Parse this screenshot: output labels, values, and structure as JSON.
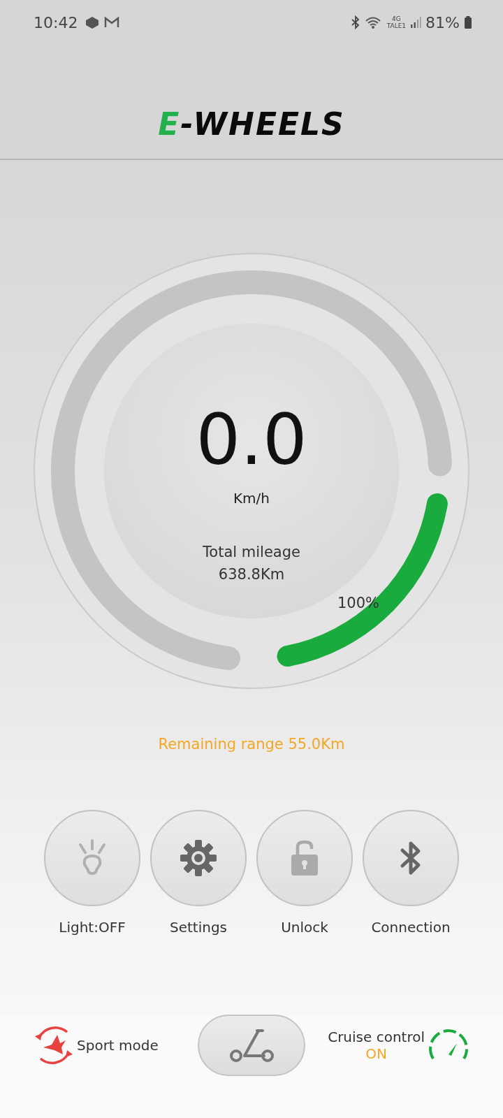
{
  "status_bar": {
    "time": "10:42",
    "network_top": "4G",
    "network_bottom": "TALE1",
    "battery": "81%"
  },
  "logo": {
    "mark": "E",
    "text": "-WHEELS"
  },
  "gauge": {
    "speed": "0.0",
    "unit": "Km/h",
    "mileage_label": "Total mileage",
    "mileage": "638.8Km"
  },
  "battery": {
    "reading": "100%"
  },
  "remaining_range": "Remaining range 55.0Km",
  "controls": [
    {
      "kind": "light",
      "label": "Light:OFF"
    },
    {
      "kind": "settings",
      "label": "Settings"
    },
    {
      "kind": "lock",
      "label": "Unlock"
    },
    {
      "kind": "bluetooth",
      "label": "Connection"
    }
  ],
  "bottom_bar": {
    "sport_mode": "Sport mode",
    "cruise_control": "Cruise control",
    "cruise_status": "ON"
  }
}
